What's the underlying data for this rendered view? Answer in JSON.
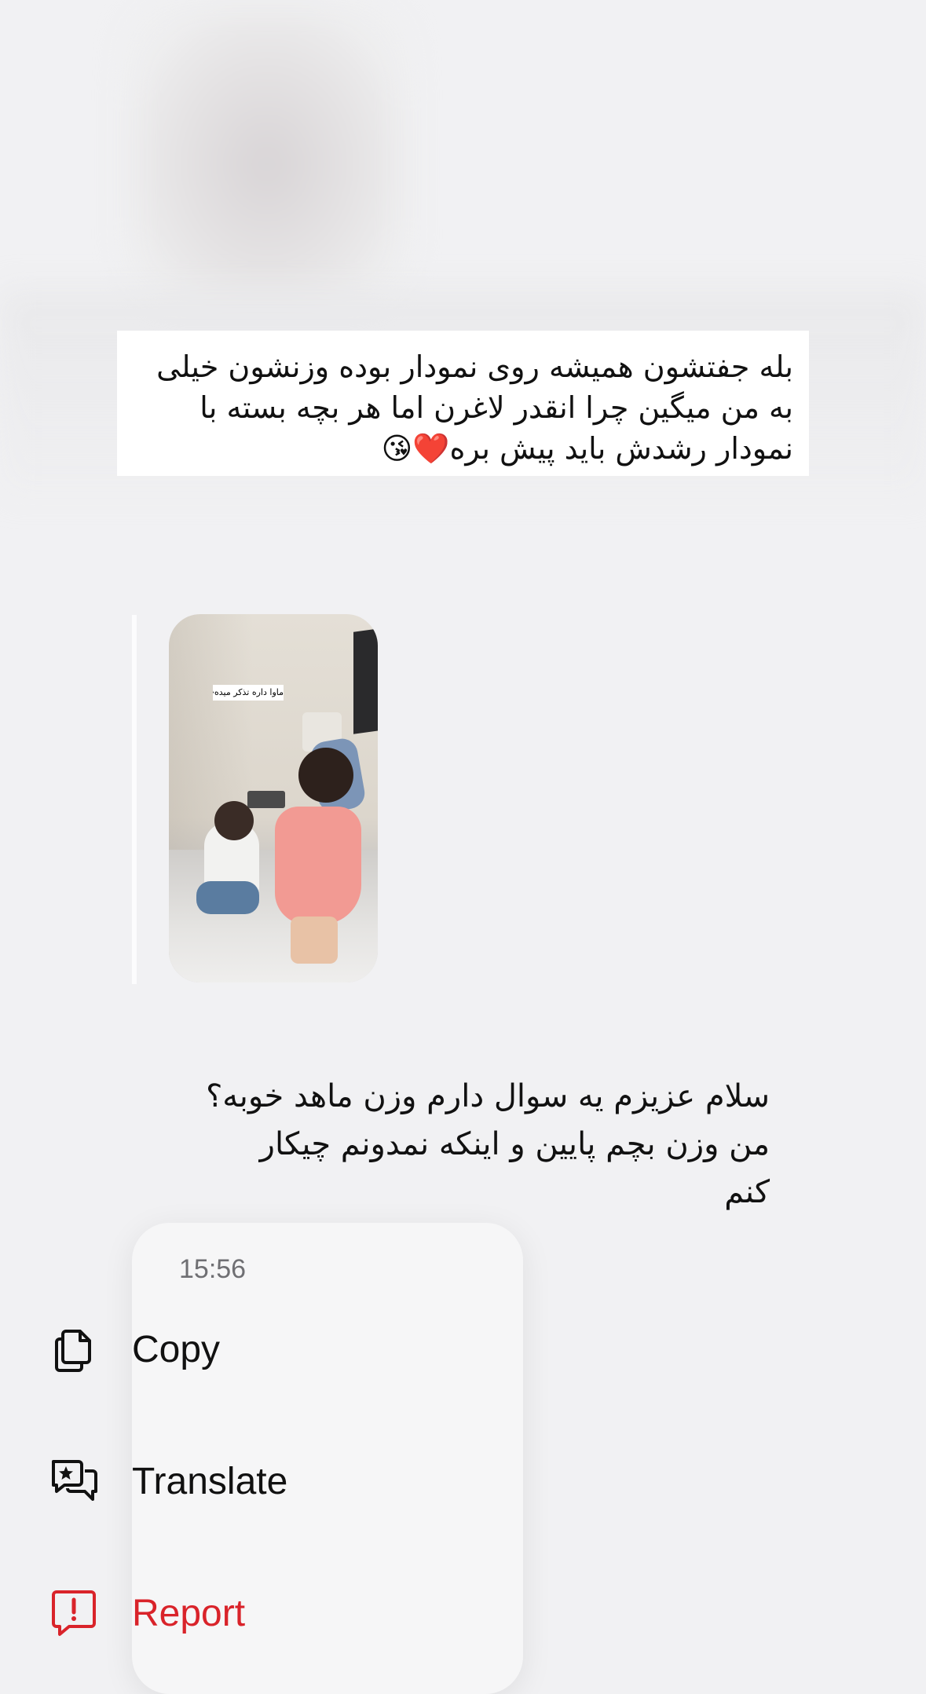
{
  "quoted_message": {
    "text": "بله جفتشون همیشه روی نمودار بوده وزنشون خیلی به من میگین چرا انقدر لاغرن اما هر بچه بسته با نمودار رشدش باید پیش بره❤️😘"
  },
  "video_message": {
    "caption_sticker": "ماوا داره تذکر میده😂"
  },
  "message": {
    "text": "سلام عزیزم یه سوال دارم وزن ماهد خوبه؟\nمن وزن بچم پایین و اینکه نمدونم چیکار\nکنم"
  },
  "context_menu": {
    "timestamp": "15:56",
    "items": [
      {
        "label": "Copy",
        "icon": "copy-icon"
      },
      {
        "label": "Translate",
        "icon": "translate-icon"
      },
      {
        "label": "Report",
        "icon": "report-icon"
      }
    ]
  },
  "colors": {
    "background": "#f1f1f3",
    "menu_background": "#f6f6f7",
    "danger": "#d9232a",
    "text": "#111111",
    "muted": "#6f6f73"
  }
}
